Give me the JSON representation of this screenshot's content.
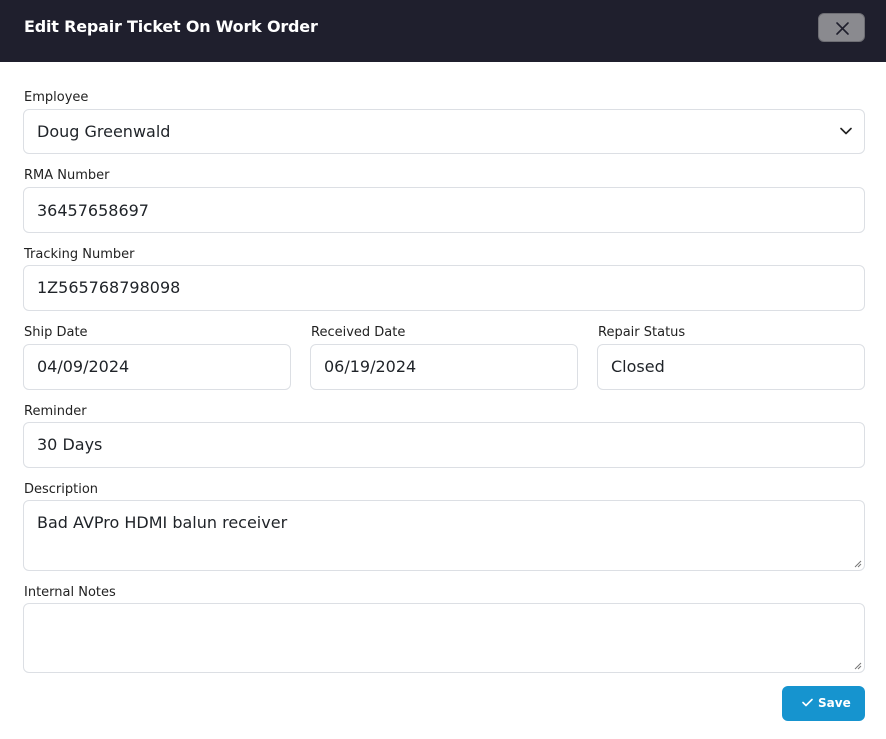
{
  "dialog": {
    "title": "Edit Repair Ticket On Work Order"
  },
  "form": {
    "employee": {
      "label": "Employee",
      "value": "Doug Greenwald"
    },
    "rma_number": {
      "label": "RMA Number",
      "value": "36457658697"
    },
    "tracking_number": {
      "label": "Tracking Number",
      "value": "1Z565768798098"
    },
    "ship_date": {
      "label": "Ship Date",
      "value": "04/09/2024"
    },
    "received_date": {
      "label": "Received Date",
      "value": "06/19/2024"
    },
    "repair_status": {
      "label": "Repair Status",
      "value": "Closed"
    },
    "reminder": {
      "label": "Reminder",
      "value": "30 Days"
    },
    "description": {
      "label": "Description",
      "value": "Bad AVPro HDMI balun receiver"
    },
    "internal_notes": {
      "label": "Internal Notes",
      "value": ""
    }
  },
  "actions": {
    "save_label": "Save"
  },
  "icons": {
    "close": "close-icon",
    "chevron": "chevron-down-icon",
    "check": "check-icon"
  },
  "colors": {
    "header_bg": "#1f1f2d",
    "close_button_bg": "#8a8a8f",
    "save_button_bg": "#1694cf",
    "field_border": "#dcdfe4"
  }
}
